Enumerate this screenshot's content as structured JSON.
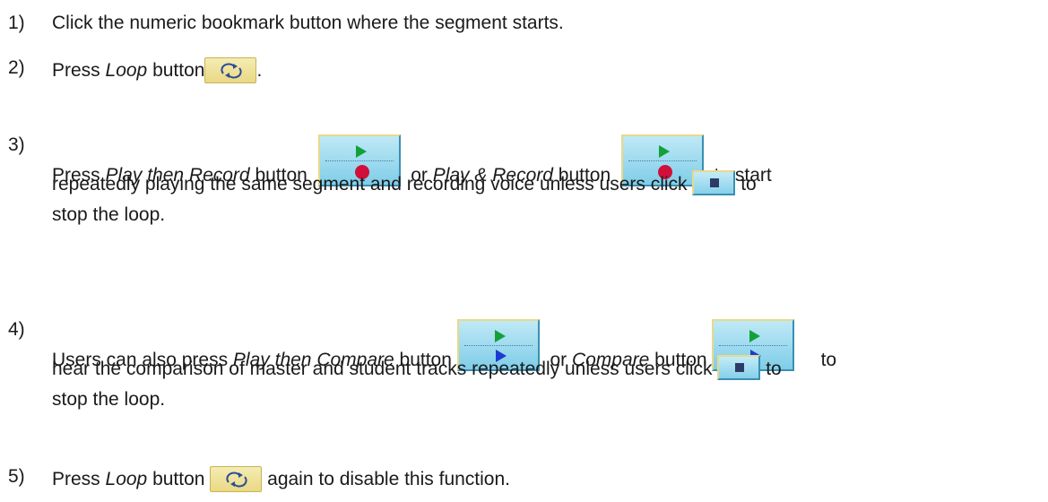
{
  "steps": [
    {
      "num": "1)",
      "text": "Click the numeric bookmark button where the segment starts."
    },
    {
      "num": "2)",
      "before": "Press ",
      "em": "Loop",
      "after": " button",
      "end": "."
    },
    {
      "num": "3)",
      "a": "Press ",
      "em1": "Play then Record",
      "b": " button",
      "c": " or ",
      "em2": "Play & Record",
      "d": " button",
      "e": " to start",
      "line2a": "repeatedly playing the same segment and recording voice unless users click",
      "line2b": " to",
      "line3": "stop the loop."
    },
    {
      "num": "4)",
      "a": "Users can also press ",
      "em1": "Play then Compare",
      "b": " button",
      "c": " or ",
      "em2": "Compare",
      "d": " button",
      "e": " to",
      "line2a": "hear the comparison of master and student tracks repeatedly unless users click",
      "line2b": " to",
      "line3": "stop the loop."
    },
    {
      "num": "5)",
      "before": "Press ",
      "em": "Loop",
      "after": " button",
      "end": " again to disable this function."
    }
  ],
  "icons": {
    "loop": "loop-icon",
    "play_then_record": "play-then-record-icon",
    "play_and_record": "play-and-record-icon",
    "play_then_compare": "play-then-compare-icon",
    "compare": "compare-icon",
    "stop": "stop-icon"
  }
}
